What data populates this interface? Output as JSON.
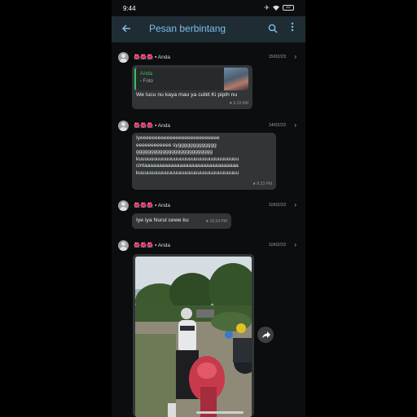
{
  "status_bar": {
    "time": "9:44",
    "battery": "22"
  },
  "app_bar": {
    "back_icon": "arrow-left-icon",
    "title": "Pesan berbintang",
    "search_icon": "search-icon",
    "menu_icon": "more-vertical-icon"
  },
  "accent_color": "#7fbfe8",
  "messages": [
    {
      "emoji": "🌺🌺🌺",
      "sender": "▪ Anda",
      "date": "15/02/23",
      "quote": {
        "name": "Anda",
        "type": "▫ Foto"
      },
      "text": "We lucu nu kaya mau ya cubit Ki pipih nu",
      "time": "6.32 AM"
    },
    {
      "emoji": "🌺🌺🌺",
      "sender": "▪ Anda",
      "date": "14/02/23",
      "lines": [
        "Iyeeeeeeeeeeeeeeeeeeeeeeeeeee",
        "eeeeeeeeeeee syggggggggggggg",
        "gggggggggggggggggggggggggg",
        "kuuuuuuuuuuuuuuuuuuuuuuuuuuuuuuuuuu",
        "cintaaaaaaaaaaaaaaaaaaaaaaaaaaaaaaaa",
        "kuuuuuuuuuuuuuuuuuuuuuuuuuuuuuuuuuu"
      ],
      "time": "8.23 PM"
    },
    {
      "emoji": "🌺🌺🌺",
      "sender": "▪ Anda",
      "date": "10/02/23",
      "text": "Iye iya Nurul cewe ku",
      "time": "10.54 PM"
    },
    {
      "emoji": "🌺🌺🌺",
      "sender": "▪ Anda",
      "date": "10/02/23",
      "media": "photo",
      "share_icon": "share-icon"
    }
  ]
}
